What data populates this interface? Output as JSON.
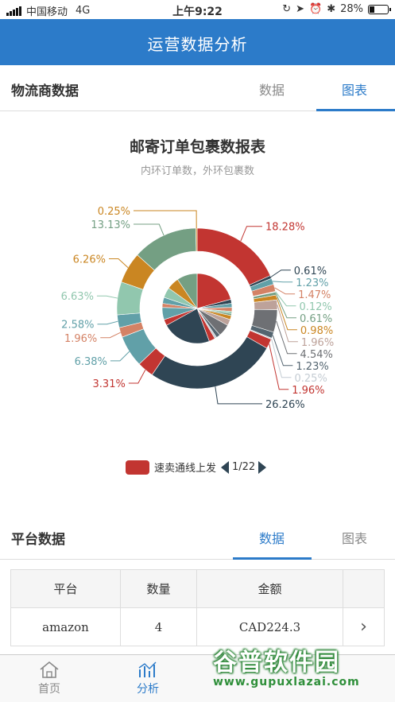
{
  "status_bar": {
    "carrier": "中国移动",
    "network": "4G",
    "time": "上午9:22",
    "battery_percent": "28%",
    "battery_level": 0.28
  },
  "nav": {
    "title": "运营数据分析"
  },
  "logistics_section": {
    "title": "物流商数据",
    "tabs": [
      {
        "label": "数据",
        "active": false
      },
      {
        "label": "图表",
        "active": true
      }
    ]
  },
  "chart_data": {
    "type": "pie",
    "title": "邮寄订单包裹数报表",
    "subtitle": "内环订单数，外环包裹数",
    "legend": {
      "first_entry": "速卖通线上发",
      "page": "1/22",
      "placement": "bottom-center"
    },
    "outer_ring": {
      "slices": [
        {
          "label": "18.28%",
          "value": 18.28,
          "color": "#c23531"
        },
        {
          "label": "0.61%",
          "value": 0.61,
          "color": "#2f4554"
        },
        {
          "label": "1.23%",
          "value": 1.23,
          "color": "#61a0a8"
        },
        {
          "label": "1.47%",
          "value": 1.47,
          "color": "#d48265"
        },
        {
          "label": "0.12%",
          "value": 0.12,
          "color": "#91c7ae"
        },
        {
          "label": "0.61%",
          "value": 0.61,
          "color": "#749f83"
        },
        {
          "label": "0.98%",
          "value": 0.98,
          "color": "#ca8622"
        },
        {
          "label": "1.96%",
          "value": 1.96,
          "color": "#bda29a"
        },
        {
          "label": "4.54%",
          "value": 4.54,
          "color": "#6e7074"
        },
        {
          "label": "1.23%",
          "value": 1.23,
          "color": "#546570"
        },
        {
          "label": "0.25%",
          "value": 0.25,
          "color": "#c4ccd3"
        },
        {
          "label": "1.96%",
          "value": 1.96,
          "color": "#c23531"
        },
        {
          "label": "26.26%",
          "value": 26.26,
          "color": "#2f4554"
        },
        {
          "label": "3.31%",
          "value": 3.31,
          "color": "#c23531"
        },
        {
          "label": "6.38%",
          "value": 6.38,
          "color": "#61a0a8"
        },
        {
          "label": "1.96%",
          "value": 1.96,
          "color": "#d48265"
        },
        {
          "label": "2.58%",
          "value": 2.58,
          "color": "#61a0a8"
        },
        {
          "label": "6.63%",
          "value": 6.63,
          "color": "#91c7ae"
        },
        {
          "label": "6.26%",
          "value": 6.26,
          "color": "#ca8622"
        },
        {
          "label": "13.13%",
          "value": 13.13,
          "color": "#749f83"
        },
        {
          "label": "0.25%",
          "value": 0.25,
          "color": "#ca8622"
        }
      ]
    },
    "inner_ring": {
      "slices": [
        {
          "value": 22,
          "color": "#c23531"
        },
        {
          "value": 2,
          "color": "#2f4554"
        },
        {
          "value": 2,
          "color": "#61a0a8"
        },
        {
          "value": 2,
          "color": "#d48265"
        },
        {
          "value": 1,
          "color": "#91c7ae"
        },
        {
          "value": 1,
          "color": "#749f83"
        },
        {
          "value": 2,
          "color": "#ca8622"
        },
        {
          "value": 3,
          "color": "#bda29a"
        },
        {
          "value": 6,
          "color": "#6e7074"
        },
        {
          "value": 2,
          "color": "#546570"
        },
        {
          "value": 1,
          "color": "#c4ccd3"
        },
        {
          "value": 3,
          "color": "#c23531"
        },
        {
          "value": 24,
          "color": "#2f4554"
        },
        {
          "value": 3,
          "color": "#c23531"
        },
        {
          "value": 6,
          "color": "#61a0a8"
        },
        {
          "value": 2,
          "color": "#d48265"
        },
        {
          "value": 3,
          "color": "#61a0a8"
        },
        {
          "value": 5,
          "color": "#91c7ae"
        },
        {
          "value": 6,
          "color": "#ca8622"
        },
        {
          "value": 10,
          "color": "#749f83"
        }
      ]
    }
  },
  "platform_section": {
    "title": "平台数据",
    "tabs": [
      {
        "label": "数据",
        "active": true
      },
      {
        "label": "图表",
        "active": false
      }
    ],
    "table": {
      "headers": [
        "平台",
        "数量",
        "金额",
        ""
      ],
      "rows": [
        {
          "platform": "amazon",
          "count": "4",
          "amount": "CAD224.3"
        }
      ]
    }
  },
  "tab_bar": {
    "items": [
      {
        "label": "首页",
        "icon": "home-icon",
        "active": false
      },
      {
        "label": "分析",
        "icon": "chart-icon",
        "active": true
      }
    ]
  },
  "watermark": {
    "text": "谷普软件园",
    "url": "www.gupuxlazai.com",
    "color": "#2f8f3a"
  }
}
